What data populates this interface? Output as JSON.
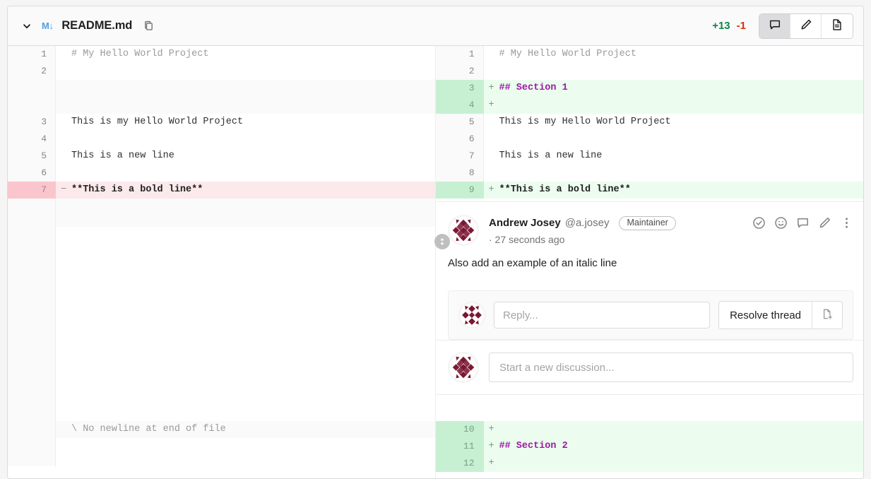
{
  "header": {
    "chevron_icon": "chevron-down-icon",
    "file_type_icon": "markdown-icon",
    "file_type_label": "M↓",
    "file_name": "README.md",
    "copy_icon": "copy-path-icon",
    "additions": "+13",
    "deletions": "-1",
    "buttons": [
      {
        "name": "toggle-comments-button",
        "icon": "comment-icon",
        "active": true
      },
      {
        "name": "edit-in-single-file-button",
        "icon": "pencil-icon",
        "active": false
      },
      {
        "name": "view-file-button",
        "icon": "file-icon",
        "active": false
      }
    ]
  },
  "diff": {
    "left": [
      {
        "num": "1",
        "sign": "",
        "text": "# My Hello World Project",
        "style": "dim",
        "type": "context"
      },
      {
        "num": "2",
        "sign": "",
        "text": "",
        "style": "",
        "type": "context"
      },
      {
        "num": "",
        "sign": "",
        "text": "",
        "style": "",
        "type": "spacer"
      },
      {
        "num": "",
        "sign": "",
        "text": "",
        "style": "",
        "type": "spacer"
      },
      {
        "num": "3",
        "sign": "",
        "text": "This is my Hello World Project",
        "style": "",
        "type": "context"
      },
      {
        "num": "4",
        "sign": "",
        "text": "",
        "style": "",
        "type": "context"
      },
      {
        "num": "5",
        "sign": "",
        "text": "This is a new line",
        "style": "",
        "type": "context"
      },
      {
        "num": "6",
        "sign": "",
        "text": "",
        "style": "",
        "type": "context"
      },
      {
        "num": "7",
        "sign": "−",
        "text": "**This is a bold line**",
        "style": "bold",
        "type": "del"
      },
      {
        "num": "",
        "sign": "",
        "text": "\\ No newline at end of file",
        "style": "dim",
        "type": "meta"
      }
    ],
    "right": [
      {
        "num": "1",
        "sign": "",
        "text": "# My Hello World Project",
        "style": "dim",
        "type": "context"
      },
      {
        "num": "2",
        "sign": "",
        "text": "",
        "style": "",
        "type": "context"
      },
      {
        "num": "3",
        "sign": "+",
        "text": "## Section 1",
        "style": "mdhead",
        "type": "add"
      },
      {
        "num": "4",
        "sign": "+",
        "text": "",
        "style": "",
        "type": "add"
      },
      {
        "num": "5",
        "sign": "",
        "text": "This is my Hello World Project",
        "style": "",
        "type": "context"
      },
      {
        "num": "6",
        "sign": "",
        "text": "",
        "style": "",
        "type": "context"
      },
      {
        "num": "7",
        "sign": "",
        "text": "This is a new line",
        "style": "",
        "type": "context"
      },
      {
        "num": "8",
        "sign": "",
        "text": "",
        "style": "",
        "type": "context"
      },
      {
        "num": "9",
        "sign": "+",
        "text": "**This is a bold line**",
        "style": "bold",
        "type": "add"
      },
      {
        "num": "10",
        "sign": "+",
        "text": "",
        "style": "",
        "type": "add"
      },
      {
        "num": "11",
        "sign": "+",
        "text": "## Section 2",
        "style": "mdhead",
        "type": "add"
      },
      {
        "num": "12",
        "sign": "+",
        "text": "",
        "style": "",
        "type": "add"
      }
    ],
    "drag_handle_icon": "vertical-resize-handle-icon"
  },
  "discussion": {
    "note": {
      "avatar_name": "user-avatar",
      "author": "Andrew Josey",
      "handle": "@a.josey",
      "role_badge": "Maintainer",
      "timestamp": "· 27 seconds ago",
      "body": "Also add an example of an italic line",
      "actions": [
        {
          "name": "resolve-thread-icon",
          "icon": "check-circle-icon"
        },
        {
          "name": "add-reaction-icon",
          "icon": "smiley-icon"
        },
        {
          "name": "reply-icon",
          "icon": "comment-icon"
        },
        {
          "name": "edit-comment-icon",
          "icon": "pencil-icon"
        },
        {
          "name": "more-actions-icon",
          "icon": "vertical-ellipsis-icon"
        }
      ]
    },
    "reply": {
      "placeholder": "Reply...",
      "value": "",
      "resolve_label": "Resolve thread",
      "create_issue_icon": "new-issue-icon"
    },
    "new_discussion": {
      "placeholder": "Start a new discussion...",
      "value": ""
    }
  },
  "colors": {
    "addition_bg": "#ecfdf0",
    "addition_gutter": "#c7f0d2",
    "deletion_bg": "#fbe9eb",
    "deletion_gutter": "#fac5cd",
    "markdown_heading": "#9b1ba0",
    "stat_add": "#108548",
    "stat_del": "#dd2b0e",
    "avatar": "#7b1733",
    "md_icon": "#4ea0e6"
  }
}
